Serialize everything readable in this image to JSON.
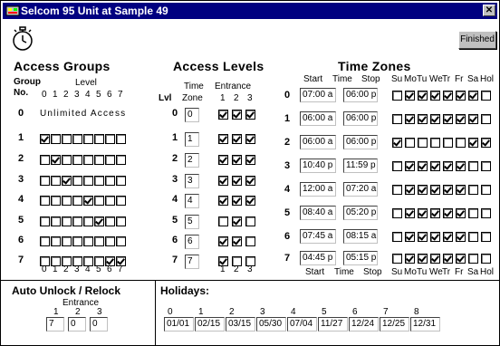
{
  "window": {
    "title": "Selcom 95  Unit at Sample 49",
    "close_label": "✕"
  },
  "toolbar": {
    "finished_label": "Finished",
    "timer_icon": "stopwatch-icon"
  },
  "access_groups": {
    "title": "Access Groups",
    "group_label": "Group",
    "no_label": "No.",
    "level_label": "Level",
    "level_numbers": [
      "0",
      "1",
      "2",
      "3",
      "4",
      "5",
      "6",
      "7"
    ],
    "unlimited_text": "Unlimited Access",
    "rows": [
      {
        "group": "0",
        "levels": null
      },
      {
        "group": "1",
        "levels": [
          true,
          false,
          false,
          false,
          false,
          false,
          false,
          false
        ]
      },
      {
        "group": "2",
        "levels": [
          false,
          true,
          false,
          false,
          false,
          false,
          false,
          false
        ]
      },
      {
        "group": "3",
        "levels": [
          false,
          false,
          true,
          false,
          false,
          false,
          false,
          false
        ]
      },
      {
        "group": "4",
        "levels": [
          false,
          false,
          false,
          false,
          true,
          false,
          false,
          false
        ]
      },
      {
        "group": "5",
        "levels": [
          false,
          false,
          false,
          false,
          false,
          true,
          false,
          false
        ]
      },
      {
        "group": "6",
        "levels": [
          false,
          false,
          false,
          false,
          false,
          false,
          false,
          false
        ]
      },
      {
        "group": "7",
        "levels": [
          false,
          false,
          false,
          false,
          false,
          false,
          true,
          true
        ]
      }
    ]
  },
  "access_levels": {
    "title": "Access Levels",
    "lvl_label": "Lvl",
    "time_label": "Time",
    "zone_label": "Zone",
    "entrance_label": "Entrance",
    "entrance_numbers": [
      "1",
      "2",
      "3"
    ],
    "rows": [
      {
        "lvl": "0",
        "zone": "0",
        "entrances": [
          true,
          true,
          true
        ]
      },
      {
        "lvl": "1",
        "zone": "1",
        "entrances": [
          true,
          true,
          true
        ]
      },
      {
        "lvl": "2",
        "zone": "2",
        "entrances": [
          true,
          true,
          true
        ]
      },
      {
        "lvl": "3",
        "zone": "3",
        "entrances": [
          true,
          true,
          true
        ]
      },
      {
        "lvl": "4",
        "zone": "4",
        "entrances": [
          true,
          true,
          true
        ]
      },
      {
        "lvl": "5",
        "zone": "5",
        "entrances": [
          false,
          true,
          false
        ]
      },
      {
        "lvl": "6",
        "zone": "6",
        "entrances": [
          true,
          true,
          false
        ]
      },
      {
        "lvl": "7",
        "zone": "7",
        "entrances": [
          true,
          false,
          false
        ]
      }
    ]
  },
  "time_zones": {
    "title": "Time Zones",
    "start_label": "Start",
    "time_label": "Time",
    "stop_label": "Stop",
    "days": [
      "Su",
      "Mo",
      "Tu",
      "We",
      "Tr",
      "Fr",
      "Sa",
      "Hol"
    ],
    "rows": [
      {
        "zone": "0",
        "start": "07:00 a",
        "stop": "06:00 p",
        "days": [
          false,
          true,
          true,
          true,
          true,
          true,
          true,
          false
        ]
      },
      {
        "zone": "1",
        "start": "06:00 a",
        "stop": "06:00 p",
        "days": [
          false,
          true,
          true,
          true,
          true,
          true,
          true,
          false
        ]
      },
      {
        "zone": "2",
        "start": "06:00 a",
        "stop": "06:00 p",
        "days": [
          true,
          false,
          false,
          false,
          false,
          false,
          true,
          true
        ]
      },
      {
        "zone": "3",
        "start": "10:40 p",
        "stop": "11:59 p",
        "days": [
          false,
          true,
          true,
          true,
          true,
          true,
          false,
          false
        ]
      },
      {
        "zone": "4",
        "start": "12:00 a",
        "stop": "07:20 a",
        "days": [
          false,
          true,
          true,
          true,
          true,
          true,
          false,
          false
        ]
      },
      {
        "zone": "5",
        "start": "08:40 a",
        "stop": "05:20 p",
        "days": [
          false,
          true,
          true,
          true,
          true,
          true,
          false,
          false
        ]
      },
      {
        "zone": "6",
        "start": "07:45 a",
        "stop": "08:15 a",
        "days": [
          false,
          true,
          true,
          true,
          true,
          true,
          false,
          false
        ]
      },
      {
        "zone": "7",
        "start": "04:45 p",
        "stop": "05:15 p",
        "days": [
          false,
          true,
          true,
          true,
          true,
          true,
          false,
          false
        ]
      }
    ]
  },
  "auto_unlock": {
    "title": "Auto Unlock / Relock",
    "entrance_label": "Entrance",
    "entrance_numbers": [
      "1",
      "2",
      "3"
    ],
    "values": [
      "7",
      "0",
      "0"
    ]
  },
  "holidays": {
    "title": "Holidays:",
    "numbers": [
      "0",
      "1",
      "2",
      "3",
      "4",
      "5",
      "6",
      "7",
      "8"
    ],
    "dates": [
      "01/01",
      "02/15",
      "03/15",
      "05/30",
      "07/04",
      "11/27",
      "12/24",
      "12/25",
      "12/31"
    ]
  }
}
